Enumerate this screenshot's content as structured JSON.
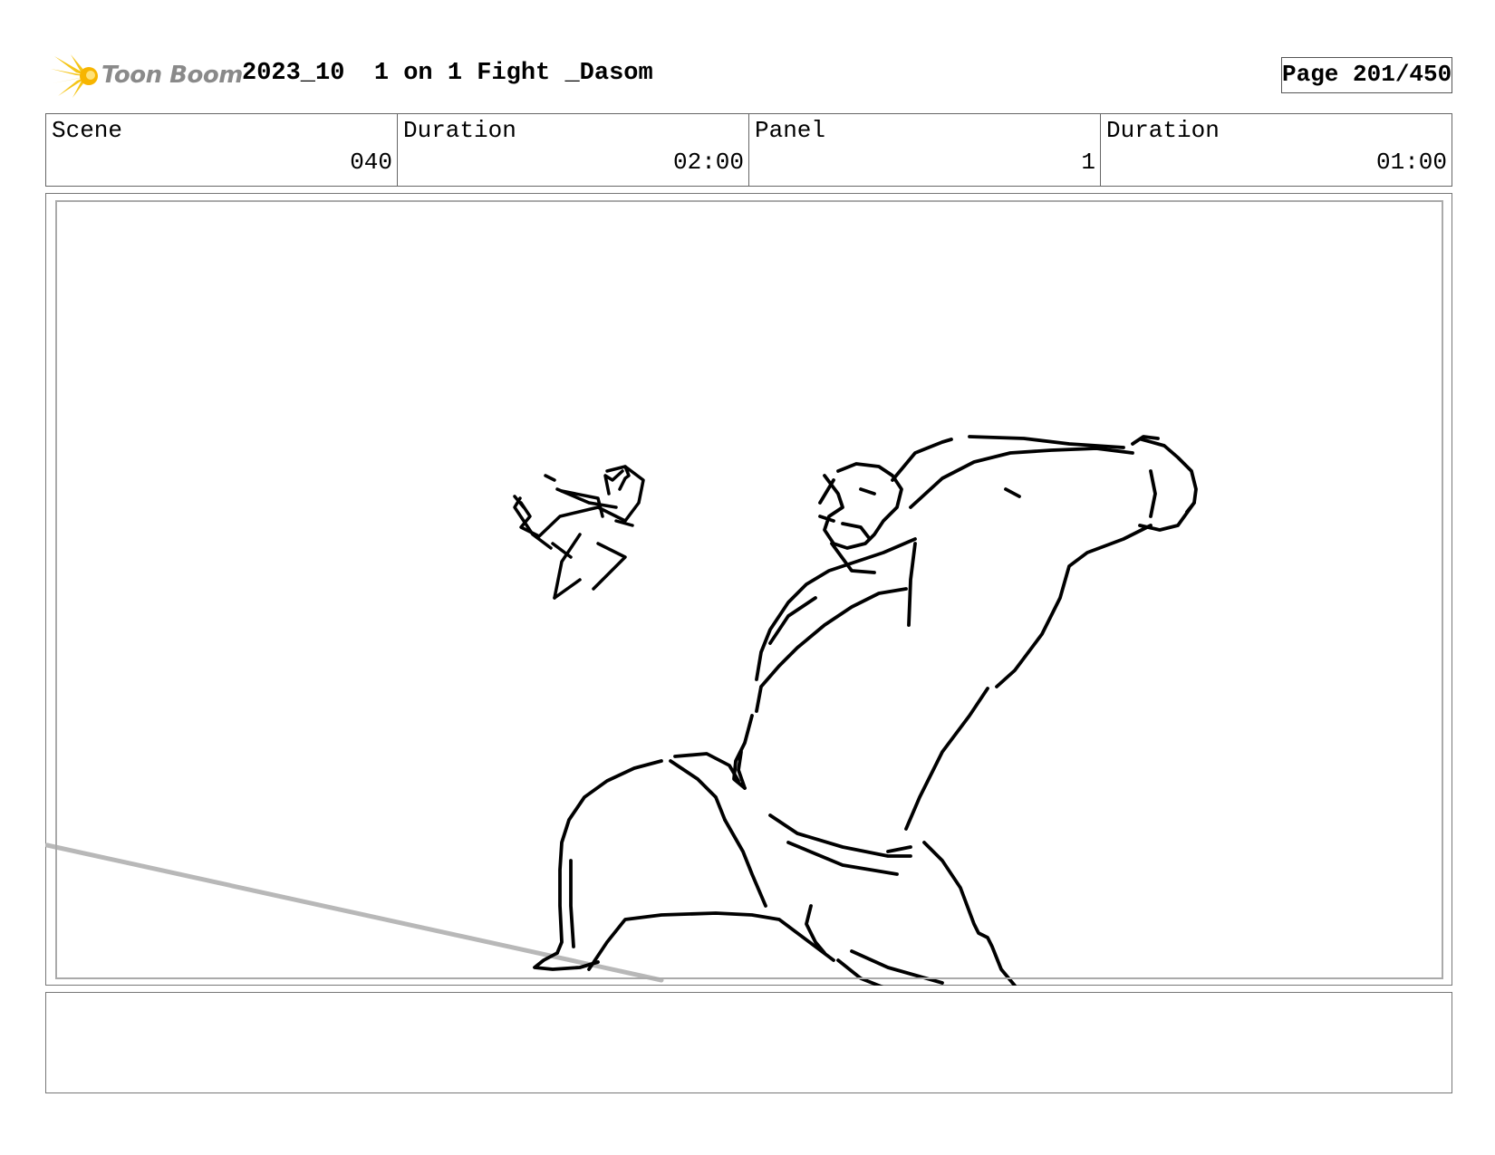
{
  "header": {
    "logo_text": "Toon Boom",
    "title": "2023_10  1 on 1 Fight _Dasom",
    "page": "Page 201/450"
  },
  "info": [
    {
      "label": "Scene",
      "value": "040"
    },
    {
      "label": "Duration",
      "value": "02:00"
    },
    {
      "label": "Panel",
      "value": "1"
    },
    {
      "label": "Duration",
      "value": "01:00"
    }
  ],
  "notes": {
    "text": ""
  },
  "colors": {
    "logo_accent": "#f5c518",
    "logo_text": "#8a8a8a",
    "ground_line": "#b8b8b8",
    "ink": "#000000"
  }
}
